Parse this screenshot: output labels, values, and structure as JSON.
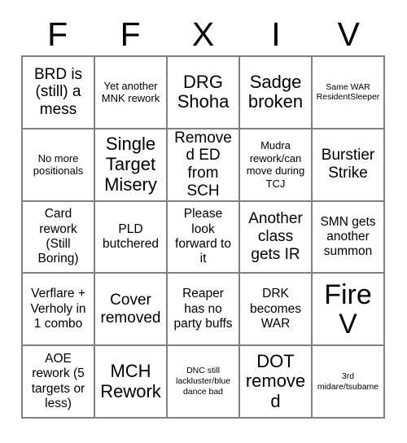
{
  "card": {
    "title_letters": [
      "F",
      "F",
      "X",
      "I",
      "V"
    ],
    "colors": {
      "background": "#ffffff",
      "text": "#000000",
      "grid_line": "#808080"
    },
    "rows": [
      [
        {
          "text": "BRD is (still) a mess",
          "size": "lg"
        },
        {
          "text": "Yet another MNK rework",
          "size": "sm"
        },
        {
          "text": "DRG Shoha",
          "size": "xl"
        },
        {
          "text": "Sadge broken",
          "size": "xl"
        },
        {
          "text": "Same WAR ResidentSleeper",
          "size": "xs"
        }
      ],
      [
        {
          "text": "No more positionals",
          "size": "sm"
        },
        {
          "text": "Single Target Misery",
          "size": "xl"
        },
        {
          "text": "Removed ED from SCH",
          "size": "lg"
        },
        {
          "text": "Mudra rework/can move during TCJ",
          "size": "sm"
        },
        {
          "text": "Burstier Strike",
          "size": "lg"
        }
      ],
      [
        {
          "text": "Card rework (Still Boring)",
          "size": "md"
        },
        {
          "text": "PLD butchered",
          "size": "md"
        },
        {
          "text": "Please look forward to it",
          "size": "md"
        },
        {
          "text": "Another class gets IR",
          "size": "lg"
        },
        {
          "text": "SMN gets another summon",
          "size": "md"
        }
      ],
      [
        {
          "text": "Verflare + Verholy in 1 combo",
          "size": "md"
        },
        {
          "text": "Cover removed",
          "size": "lg"
        },
        {
          "text": "Reaper has no party buffs",
          "size": "md"
        },
        {
          "text": "DRK becomes WAR",
          "size": "md"
        },
        {
          "text": "Fire V",
          "size": "xxl"
        }
      ],
      [
        {
          "text": "AOE rework (5 targets or less)",
          "size": "md"
        },
        {
          "text": "MCH Rework",
          "size": "xl"
        },
        {
          "text": "DNC still lackluster/blue dance bad",
          "size": "xs"
        },
        {
          "text": "DOT removed",
          "size": "xl"
        },
        {
          "text": "3rd midare/tsubame",
          "size": "xs"
        }
      ]
    ]
  }
}
